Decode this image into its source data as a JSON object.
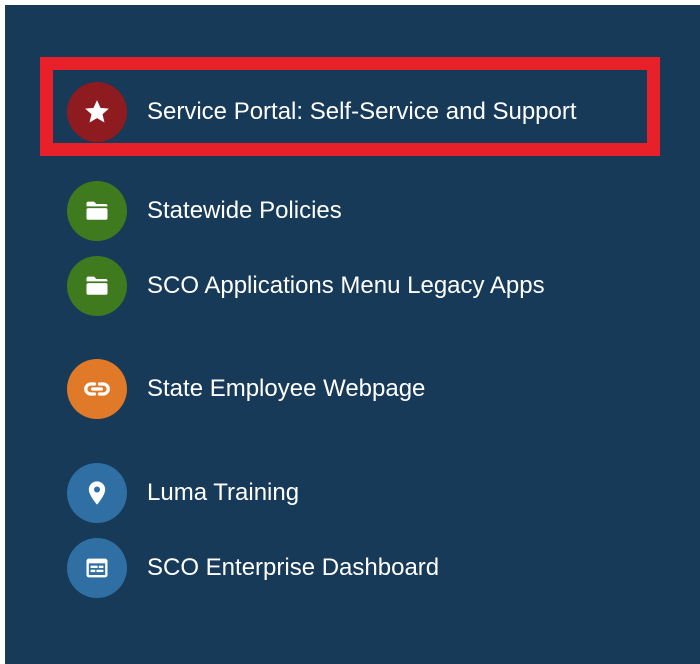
{
  "menu": {
    "items": [
      {
        "label": "Service Portal: Self-Service and Support",
        "icon": "star-icon",
        "color": "#8d1b1f"
      },
      {
        "label": "Statewide Policies",
        "icon": "folder-icon",
        "color": "#3f7a1f"
      },
      {
        "label": "SCO Applications Menu Legacy Apps",
        "icon": "folder-icon",
        "color": "#3f7a1f"
      },
      {
        "label": "State Employee Webpage",
        "icon": "link-icon",
        "color": "#e07a28"
      },
      {
        "label": "Luma Training",
        "icon": "location-pin-icon",
        "color": "#2f6fa3"
      },
      {
        "label": "SCO Enterprise Dashboard",
        "icon": "dashboard-icon",
        "color": "#2f6fa3"
      }
    ]
  },
  "colors": {
    "panel_background": "#163a57",
    "highlight_border": "#e8202a",
    "text": "#ffffff"
  }
}
